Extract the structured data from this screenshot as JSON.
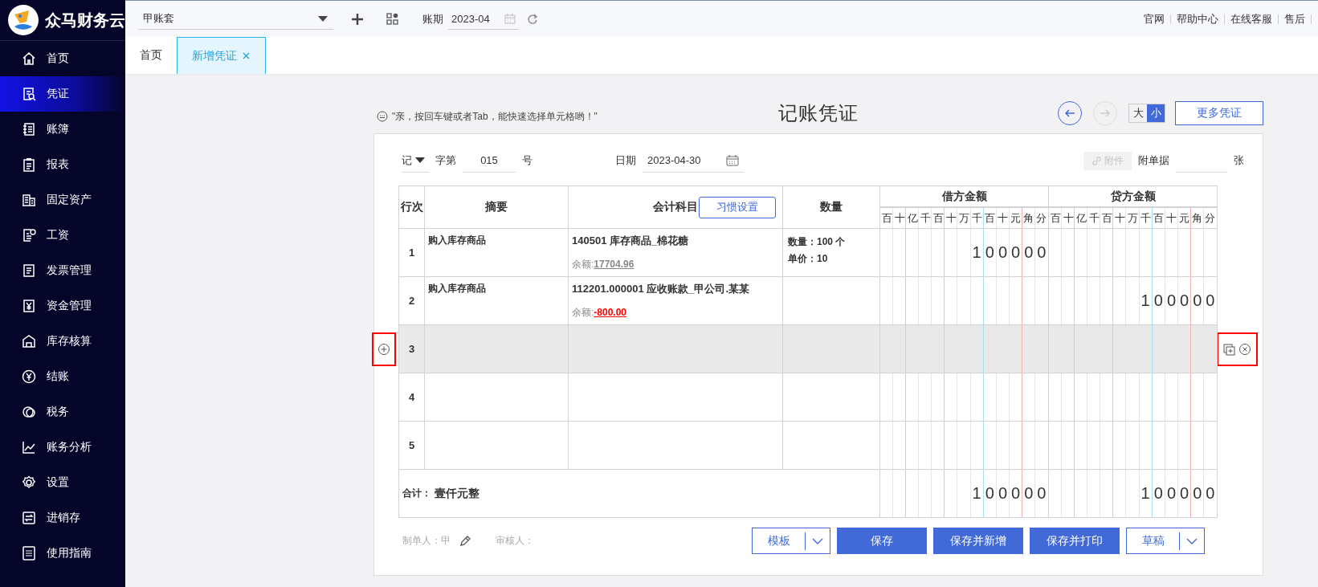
{
  "app": {
    "logo": "众马财务云"
  },
  "topbar": {
    "account_set": "甲账套",
    "period_label": "账期",
    "period": "2023-04",
    "links": [
      "官网",
      "帮助中心",
      "在线客服",
      "售后"
    ]
  },
  "tabs": [
    {
      "label": "首页",
      "selected": false,
      "closable": false
    },
    {
      "label": "新增凭证",
      "selected": true,
      "closable": true
    }
  ],
  "sidebar": {
    "items": [
      {
        "label": "首页",
        "selected": false
      },
      {
        "label": "凭证",
        "selected": true
      },
      {
        "label": "账簿",
        "selected": false
      },
      {
        "label": "报表",
        "selected": false
      },
      {
        "label": "固定资产",
        "selected": false
      },
      {
        "label": "工资",
        "selected": false
      },
      {
        "label": "发票管理",
        "selected": false
      },
      {
        "label": "资金管理",
        "selected": false
      },
      {
        "label": "库存核算",
        "selected": false
      },
      {
        "label": "结账",
        "selected": false
      },
      {
        "label": "税务",
        "selected": false
      },
      {
        "label": "账务分析",
        "selected": false
      },
      {
        "label": "设置",
        "selected": false
      },
      {
        "label": "进销存",
        "selected": false
      },
      {
        "label": "使用指南",
        "selected": false
      }
    ]
  },
  "voucher": {
    "hint": "\"亲，按回车键或者Tab，能快速选择单元格哟！\"",
    "title": "记账凭证",
    "nav_buttons": [
      {
        "kind": "previous",
        "disabled": false
      },
      {
        "kind": "next",
        "disabled": true
      }
    ],
    "size_options": [
      {
        "label": "大",
        "selected": false
      },
      {
        "label": "小",
        "selected": true
      }
    ],
    "more_button": "更多凭证",
    "fields": {
      "word": "记",
      "word_label": "字第",
      "number": "015",
      "number_suffix": "号",
      "date_label": "日期",
      "date": "2023-04-30",
      "attachment_button": "附件",
      "attachment_disabled": true,
      "attachments_label": "附单据",
      "attachments_unit": "张"
    },
    "table": {
      "columns": {
        "row_no": "行次",
        "summary": "摘要",
        "account": "会计科目",
        "habit_button": "习惯设置",
        "quantity": "数量",
        "debit": "借方金额",
        "credit": "贷方金额",
        "debit_units": [
          "百",
          "十",
          "亿",
          "千",
          "百",
          "十",
          "万",
          "千",
          "百",
          "十",
          "元",
          "角",
          "分"
        ],
        "credit_units": [
          "百",
          "十",
          "亿",
          "千",
          "百",
          "十",
          "万",
          "千",
          "百",
          "十",
          "元",
          "角",
          "分"
        ]
      },
      "rows": [
        {
          "no": "1",
          "summary": "购入库存商品",
          "account": "140501 库存商品_棉花糖",
          "balance_label": "余额:",
          "balance": "17704.96",
          "negative": false,
          "quantity_lines": [
            "数量：100 个",
            "单价：10"
          ],
          "debit": "100000",
          "highlighted": false
        },
        {
          "no": "2",
          "summary": "购入库存商品",
          "account": "112201.000001 应收账款_甲公司.某某",
          "balance_label": "余额:",
          "balance": "-800.00",
          "negative": true,
          "credit": "100000",
          "highlighted": false
        },
        {
          "no": "3",
          "highlighted": true
        },
        {
          "no": "4",
          "highlighted": false
        },
        {
          "no": "5",
          "highlighted": false
        }
      ],
      "total": {
        "label": "合计：",
        "amount_words": "壹仟元整",
        "debit": "100000",
        "credit": "100000"
      }
    },
    "footer": {
      "maker_label": "制单人：",
      "maker": "甲",
      "reviewer_label": "审核人：",
      "buttons": [
        {
          "label": "模板",
          "kind": "split"
        },
        {
          "label": "保存",
          "kind": "primary"
        },
        {
          "label": "保存并新增",
          "kind": "primary"
        },
        {
          "label": "保存并打印",
          "kind": "primary"
        },
        {
          "label": "草稿",
          "kind": "split"
        }
      ]
    }
  }
}
